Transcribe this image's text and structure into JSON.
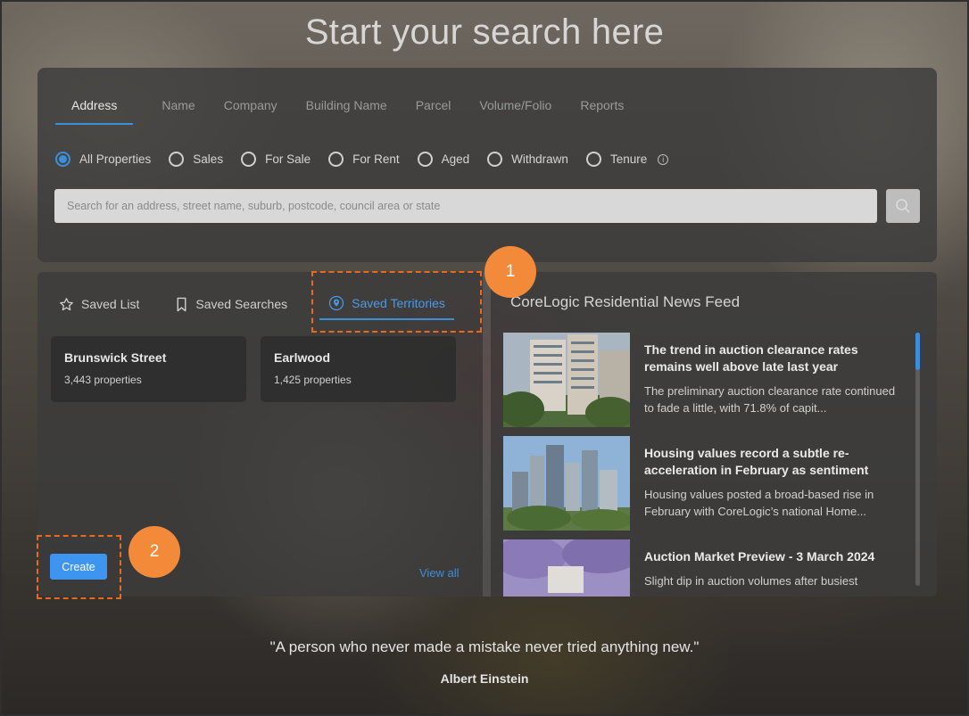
{
  "page_title": "Start your search here",
  "search": {
    "tabs": [
      "Address",
      "Name",
      "Company",
      "Building Name",
      "Parcel",
      "Volume/Folio",
      "Reports"
    ],
    "active_tab": "Address",
    "filters": [
      "All Properties",
      "Sales",
      "For Sale",
      "For Rent",
      "Aged",
      "Withdrawn",
      "Tenure"
    ],
    "selected_filter": "All Properties",
    "placeholder": "Search for an address, street name, suburb, postcode, council area or state",
    "value": ""
  },
  "saved": {
    "tabs": [
      "Saved List",
      "Saved Searches",
      "Saved Territories"
    ],
    "active_tab": "Saved Territories",
    "territories": [
      {
        "name": "Brunswick Street",
        "count": "3,443 properties"
      },
      {
        "name": "Earlwood",
        "count": "1,425 properties"
      }
    ],
    "create_label": "Create",
    "view_all_label": "View all"
  },
  "news": {
    "title": "CoreLogic Residential News Feed",
    "items": [
      {
        "headline": "The trend in auction clearance rates remains well above late last year",
        "snippet": "The preliminary auction clearance rate continued to fade a little, with 71.8% of capit..."
      },
      {
        "headline": "Housing values record a subtle re-acceleration in February as sentiment",
        "snippet": "Housing values posted a broad-based rise in February with CoreLogic’s national Home..."
      },
      {
        "headline": "Auction Market Preview - 3 March 2024",
        "snippet": "Slight dip in auction volumes after busiest"
      }
    ]
  },
  "annotations": {
    "badge1": "1",
    "badge2": "2"
  },
  "quote": {
    "text": "\"A person who never made a mistake never tried anything new.\"",
    "author": "Albert Einstein"
  },
  "colors": {
    "accent": "#3d8ed9",
    "button": "#3d95f0",
    "annotation": "#f28a3a"
  }
}
